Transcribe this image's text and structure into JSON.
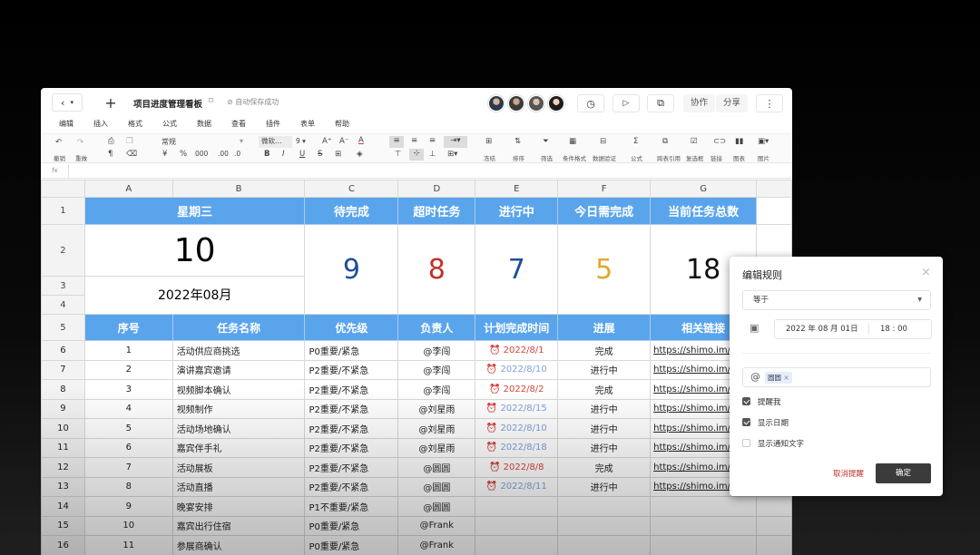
{
  "toolbar": {
    "doc_title": "项目进度管理看板",
    "saved_status": "自动保存成功",
    "collaborate": "协作",
    "share": "分享"
  },
  "menu": [
    "编辑",
    "插入",
    "格式",
    "公式",
    "数据",
    "查看",
    "插件",
    "表单",
    "帮助"
  ],
  "ribbon": {
    "undo": "撤销",
    "redo": "重做",
    "format_select": "常规",
    "font_select": "微软…",
    "font_size": "9",
    "currency": "¥",
    "percent": "%",
    "thousand": "000",
    "dec_add": ".00",
    "dec_remove": ".0",
    "bold": "B",
    "italic": "I",
    "underline": "U",
    "strike": "S",
    "freeze": "冻结",
    "sort": "排序",
    "filter": "筛选",
    "cond_format": "条件格式",
    "validation": "数据验证",
    "formula": "公式",
    "cross_ref": "跨表引用",
    "checkbox": "复选框",
    "link": "链接",
    "chart": "图表",
    "image": "图片"
  },
  "formula_bar": {
    "fx": "fx"
  },
  "sheet": {
    "columns": [
      "A",
      "B",
      "C",
      "D",
      "E",
      "F",
      "G"
    ],
    "row1": {
      "weekday": "星期三",
      "pending": "待完成",
      "overdue": "超时任务",
      "in_progress": "进行中",
      "due_today": "今日需完成",
      "total": "当前任务总数"
    },
    "day": "10",
    "month": "2022年08月",
    "counts": {
      "pending": "9",
      "overdue": "8",
      "in_progress": "7",
      "due_today": "5",
      "total": "18"
    },
    "headers": [
      "序号",
      "任务名称",
      "优先级",
      "负责人",
      "计划完成时间",
      "进展",
      "相关链接"
    ],
    "rows": [
      {
        "no": "1",
        "task": "活动供应商挑选",
        "priority": "P0重要/紧急",
        "owner": "@李闯",
        "date": "2022/8/1",
        "status": "完成",
        "link": "https://shimo.im/"
      },
      {
        "no": "2",
        "task": "演讲嘉宾邀请",
        "priority": "P2重要/不紧急",
        "owner": "@李闯",
        "date": "2022/8/10",
        "status": "进行中",
        "link": "https://shimo.im/"
      },
      {
        "no": "3",
        "task": "视频脚本确认",
        "priority": "P2重要/不紧急",
        "owner": "@李闯",
        "date": "2022/8/2",
        "status": "完成",
        "link": "https://shimo.im/"
      },
      {
        "no": "4",
        "task": "视频制作",
        "priority": "P2重要/不紧急",
        "owner": "@刘星雨",
        "date": "2022/8/15",
        "status": "进行中",
        "link": "https://shimo.im/"
      },
      {
        "no": "5",
        "task": "活动场地确认",
        "priority": "P2重要/不紧急",
        "owner": "@刘星雨",
        "date": "2022/8/10",
        "status": "进行中",
        "link": "https://shimo.im/"
      },
      {
        "no": "6",
        "task": "嘉宾伴手礼",
        "priority": "P2重要/不紧急",
        "owner": "@刘星雨",
        "date": "2022/8/18",
        "status": "进行中",
        "link": "https://shimo.im/"
      },
      {
        "no": "7",
        "task": "活动展板",
        "priority": "P2重要/不紧急",
        "owner": "@圆圆",
        "date": "2022/8/8",
        "status": "完成",
        "link": "https://shimo.im/"
      },
      {
        "no": "8",
        "task": "活动直播",
        "priority": "P2重要/不紧急",
        "owner": "@圆圆",
        "date": "2022/8/11",
        "status": "进行中",
        "link": "https://shimo.im/"
      },
      {
        "no": "9",
        "task": "晚宴安排",
        "priority": "P1不重要/紧急",
        "owner": "@圆圆",
        "date": "",
        "status": "",
        "link": ""
      },
      {
        "no": "10",
        "task": "嘉宾出行住宿",
        "priority": "P0重要/紧急",
        "owner": "@Frank",
        "date": "",
        "status": "",
        "link": ""
      },
      {
        "no": "11",
        "task": "参展商确认",
        "priority": "P0重要/紧急",
        "owner": "@Frank",
        "date": "",
        "status": "",
        "link": ""
      }
    ]
  },
  "colors": {
    "header_blue": "#5aa4ec",
    "pending": "#1f4e9a",
    "overdue": "#c0312b",
    "in_progress": "#1f4e9a",
    "due_today": "#e3a72f",
    "total": "#111111"
  },
  "panel": {
    "title": "编辑规则",
    "condition": "等于",
    "date": "2022 年 08 月 01日",
    "time": "18 : 00",
    "mention": "圆圆",
    "opt1": "提醒我",
    "opt2": "显示日期",
    "opt3": "显示通知文字",
    "cancel": "取消提醒",
    "confirm": "确定"
  }
}
